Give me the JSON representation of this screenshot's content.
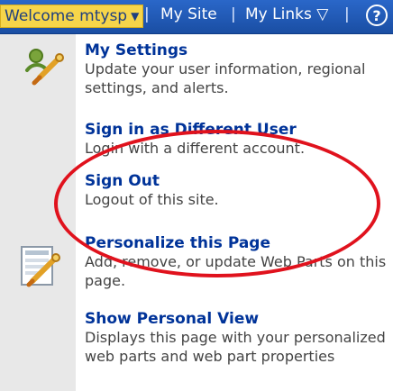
{
  "topbar": {
    "welcome_label": "Welcome mtysp",
    "welcome_caret": "▼",
    "separators": [
      "|",
      "|",
      "|"
    ],
    "links": [
      "My Site",
      "My Links ▽"
    ],
    "help_label": "?"
  },
  "menu": {
    "items": [
      {
        "title": "My Settings",
        "description": "Update your user information, regional settings, and alerts.",
        "icon": "settings-icon"
      },
      {
        "title": "Sign in as Different User",
        "description": "Login with a different account."
      },
      {
        "title": "Sign Out",
        "description": "Logout of this site."
      },
      {
        "title": "Personalize this Page",
        "description": "Add, remove, or update Web Parts on this page.",
        "icon": "personalize-page-icon"
      },
      {
        "title": "Show Personal View",
        "description": "Displays this page with your personalized web parts and web part properties"
      }
    ]
  },
  "colors": {
    "topbar": "#1f55ad",
    "welcome_highlight": "#f6d54a",
    "menu_title": "#003399",
    "annotation": "#e0121d"
  }
}
